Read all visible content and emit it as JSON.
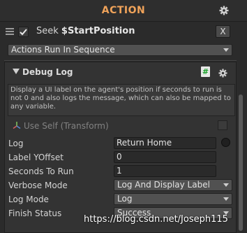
{
  "header": {
    "title": "ACTION",
    "settings_icon": "gear-icon"
  },
  "task": {
    "checked": true,
    "label_prefix": "Seek ",
    "label_var": "$StartPosition",
    "remove_label": "X",
    "mode": "Actions Run In Sequence"
  },
  "debug": {
    "title": "Debug Log",
    "script_icon": "hash-icon",
    "description": "Display a UI label on the agent's position if seconds to run is not 0 and also logs the message, which can also be mapped to any variable.",
    "use_self": "Use Self (Transform)"
  },
  "fields": {
    "log": {
      "label": "Log",
      "value": "Return Home"
    },
    "label_yoffset": {
      "label": "Label YOffset",
      "value": "0"
    },
    "seconds_to_run": {
      "label": "Seconds To Run",
      "value": "1"
    },
    "verbose_mode": {
      "label": "Verbose Mode",
      "value": "Log And Display Label"
    },
    "log_mode": {
      "label": "Log Mode",
      "value": "Log"
    },
    "finish_status": {
      "label": "Finish Status",
      "value": "Success"
    }
  },
  "watermark": "https://blog.csdn.net/Joseph115",
  "colors": {
    "accent": "#f0a35a",
    "background": "#2b2b2b",
    "panel": "#333333",
    "script_icon": "#1aa12a"
  }
}
